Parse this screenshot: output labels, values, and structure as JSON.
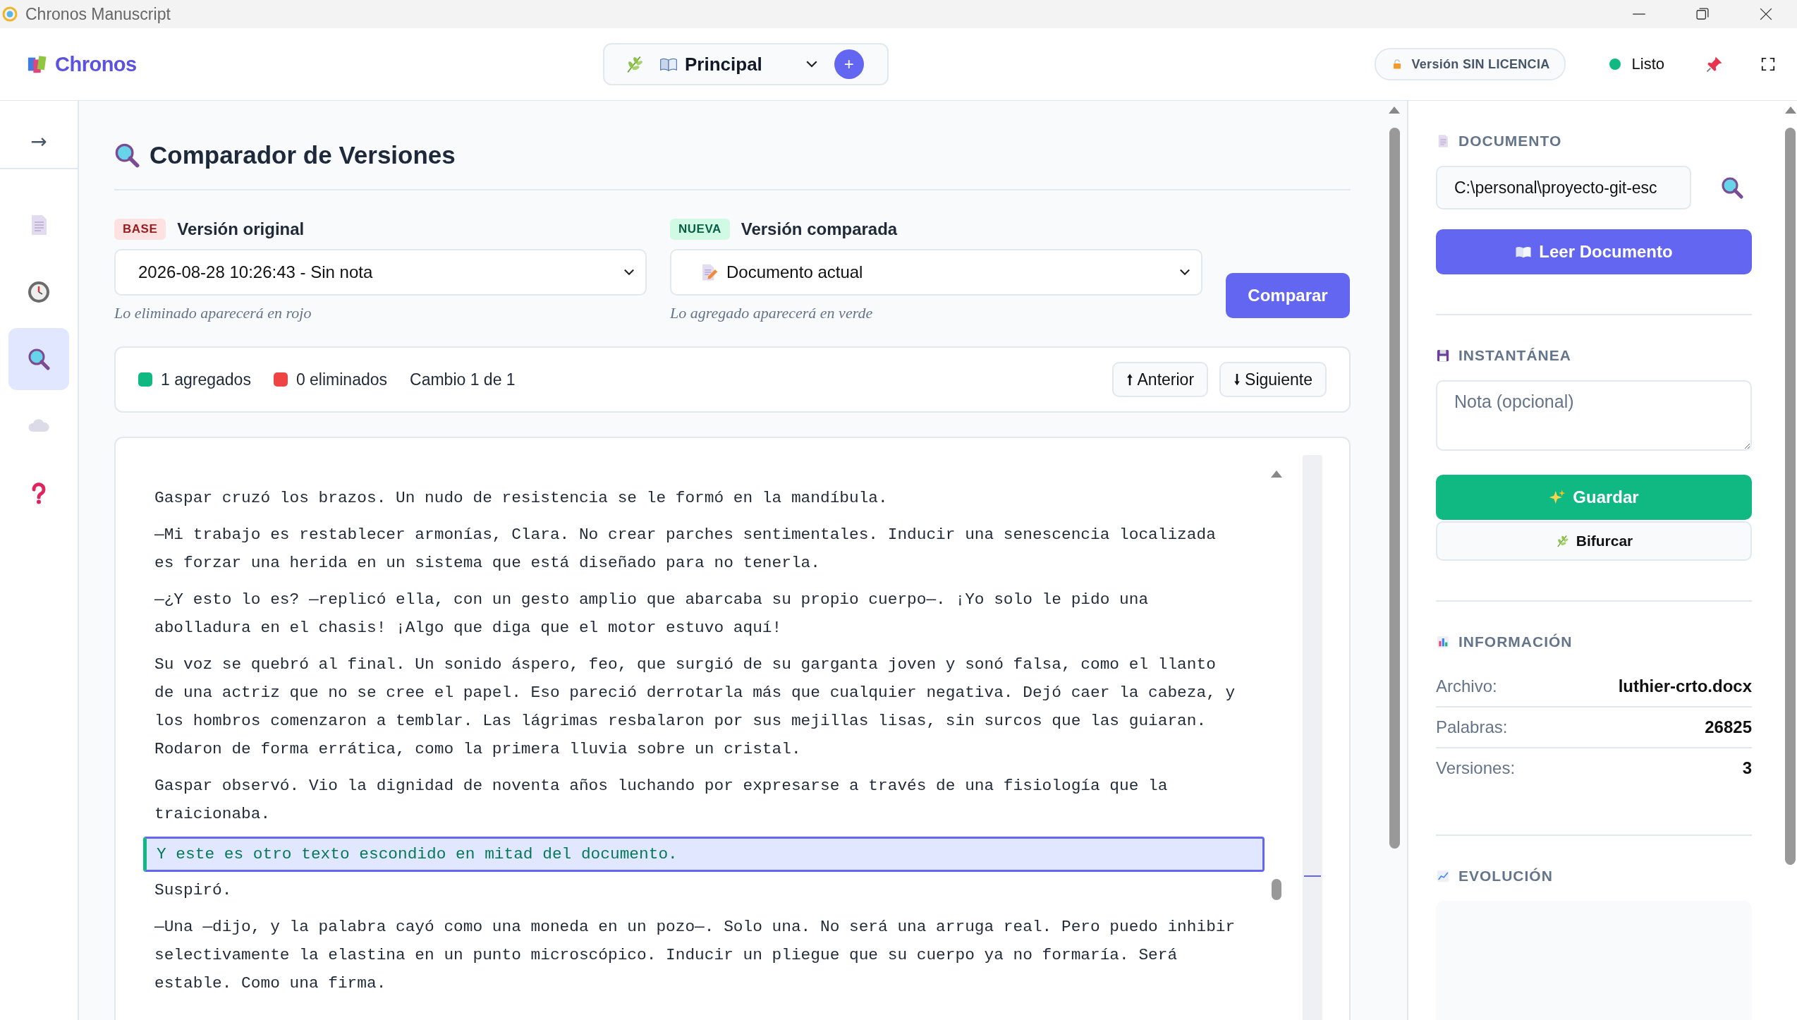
{
  "window": {
    "title": "Chronos Manuscript"
  },
  "header": {
    "logo": "Chronos",
    "branch": {
      "name": "Principal",
      "add_button": "+"
    },
    "license": "Versión SIN LICENCIA",
    "status": "Listo"
  },
  "nav": {
    "toggle": "→",
    "items": [
      {
        "kind": "document",
        "selected": false
      },
      {
        "kind": "history",
        "selected": false
      },
      {
        "kind": "compare",
        "selected": true
      },
      {
        "kind": "cloud",
        "selected": false
      },
      {
        "kind": "help",
        "selected": false
      }
    ]
  },
  "comparator": {
    "title": "Comparador de Versiones",
    "base": {
      "badge": "BASE",
      "label": "Versión original",
      "value": "2026-08-28 10:26:43 - Sin nota",
      "hint": "Lo eliminado aparecerá en rojo"
    },
    "new": {
      "badge": "NUEVA",
      "label": "Versión comparada",
      "value": "Documento actual",
      "hint": "Lo agregado aparecerá en verde"
    },
    "compare_button": "Comparar",
    "stats": [
      {
        "label": "1 agregados",
        "color": "#10b981"
      },
      {
        "label": "0 eliminados",
        "color": "#ef4444"
      }
    ],
    "position": "Cambio 1 de 1",
    "prev_button": "Anterior",
    "next_button": "Siguiente",
    "paragraphs": [
      {
        "kind": "plain",
        "text": "Gaspar cruzó los brazos. Un nudo de resistencia se le formó en la mandíbula."
      },
      {
        "kind": "plain",
        "text": "—Mi trabajo es restablecer armonías, Clara. No crear parches sentimentales. Inducir una senescencia localizada es forzar una herida en un sistema que está diseñado para no tenerla."
      },
      {
        "kind": "plain",
        "text": "—¿Y esto lo es? —replicó ella, con un gesto amplio que abarcaba su propio cuerpo—. ¡Yo solo le pido una abolladura en el chasis! ¡Algo que diga que el motor estuvo aquí!"
      },
      {
        "kind": "plain",
        "text": "Su voz se quebró al final. Un sonido áspero, feo, que surgió de su garganta joven y sonó falsa, como el llanto de una actriz que no se cree el papel. Eso pareció derrotarla más que cualquier negativa. Dejó caer la cabeza, y los hombros comenzaron a temblar. Las lágrimas resbalaron por sus mejillas lisas, sin surcos que las guiaran. Rodaron de forma errática, como la primera lluvia sobre un cristal."
      },
      {
        "kind": "plain",
        "text": "Gaspar observó. Vio la dignidad de noventa años luchando por expresarse a través de una fisiología que la traicionaba."
      },
      {
        "kind": "added",
        "text": "Y este es otro texto escondido en mitad del documento."
      },
      {
        "kind": "plain",
        "text": "Suspiró."
      },
      {
        "kind": "plain",
        "text": "—Una —dijo, y la palabra cayó como una moneda en un pozo—. Solo una. No será una arruga real. Pero puedo inhibir selectivamente la elastina en un punto microscópico. Inducir un pliegue que su cuerpo ya no formaría. Será estable. Como una firma."
      }
    ]
  },
  "side": {
    "document": {
      "title": "DOCUMENTO",
      "path": "C:\\personal\\proyecto-git-esc",
      "read_button": "Leer Documento"
    },
    "snapshot": {
      "title": "INSTANTÁNEA",
      "placeholder": "Nota (opcional)",
      "save_button": "Guardar",
      "fork_button": "Bifurcar"
    },
    "info": {
      "title": "INFORMACIÓN",
      "rows": [
        {
          "label": "Archivo:",
          "value": "luthier-crto.docx"
        },
        {
          "label": "Palabras:",
          "value": "26825"
        },
        {
          "label": "Versiones:",
          "value": "3"
        }
      ]
    },
    "evolution": {
      "title": "EVOLUCIÓN"
    }
  }
}
